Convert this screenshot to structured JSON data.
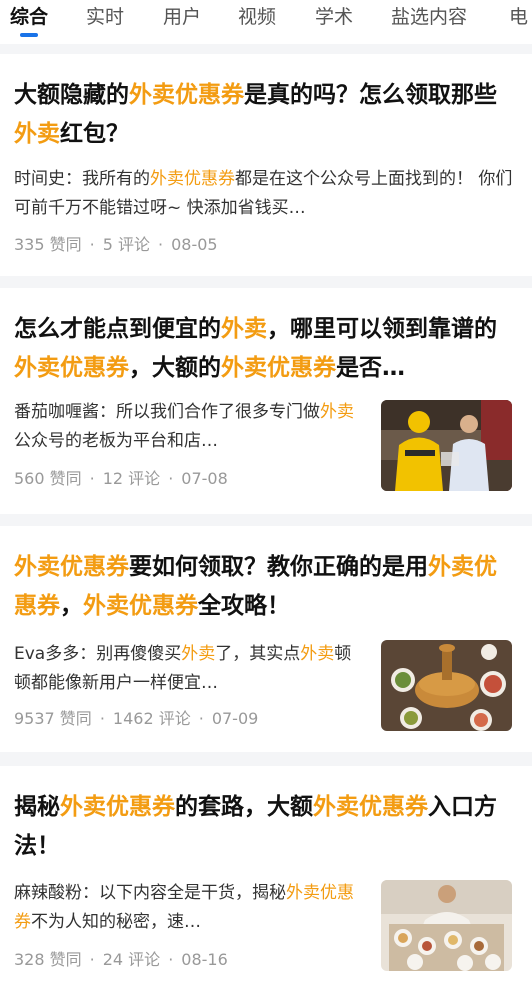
{
  "tabs": [
    {
      "label": "综合",
      "active": true
    },
    {
      "label": "实时",
      "active": false
    },
    {
      "label": "用户",
      "active": false
    },
    {
      "label": "视频",
      "active": false
    },
    {
      "label": "学术",
      "active": false
    },
    {
      "label": "盐选内容",
      "active": false
    },
    {
      "label": "电",
      "active": false
    }
  ],
  "highlight_color": "#f39c12",
  "tab_indicator_color": "#1a73e8",
  "results": [
    {
      "title_parts": [
        "大额隐藏的",
        "外卖优惠券",
        "是真的吗？怎么领取那些",
        "外卖",
        "红包？"
      ],
      "excerpt_parts": [
        "时间史：我所有的",
        "外卖优惠券",
        "都是在这个公众号上面找到的！ 你们可前千万不能错过呀~ 快添加省钱买…"
      ],
      "meta": {
        "likes": "335 赞同",
        "comments": "5 评论",
        "date": "08-05"
      },
      "thumbnail": ""
    },
    {
      "title_parts": [
        "怎么才能点到便宜的",
        "外卖",
        "，哪里可以领到靠谱的",
        "外卖优惠券",
        "，大额的",
        "外卖优惠券",
        "是否…"
      ],
      "excerpt_parts": [
        "番茄咖喱酱：所以我们合作了很多专门做",
        "外卖",
        "公众号的老板为平台和店…"
      ],
      "meta": {
        "likes": "560 赞同",
        "comments": "12 评论",
        "date": "07-08"
      },
      "thumbnail": "delivery-courier-image"
    },
    {
      "title_parts": [
        "外卖优惠券",
        "要如何领取？教你正确的是用",
        "外卖优惠券",
        "，",
        "外卖优惠券",
        "全攻略！"
      ],
      "excerpt_parts": [
        "Eva多多：别再傻傻买",
        "外卖",
        "了，其实点",
        "外卖",
        "顿顿都能像新用户一样便宜…"
      ],
      "meta": {
        "likes": "9537 赞同",
        "comments": "1462 评论",
        "date": "07-09"
      },
      "thumbnail": "hotpot-image"
    },
    {
      "title_parts": [
        "揭秘",
        "外卖优惠券",
        "的套路，大额",
        "外卖优惠券",
        "入口方法！"
      ],
      "excerpt_parts": [
        "麻辣酸粉：以下内容全是干货，揭秘",
        "外卖优惠券",
        "不为人知的秘密，速…"
      ],
      "meta": {
        "likes": "328 赞同",
        "comments": "24 评论",
        "date": "08-16"
      },
      "thumbnail": "food-table-image"
    }
  ]
}
